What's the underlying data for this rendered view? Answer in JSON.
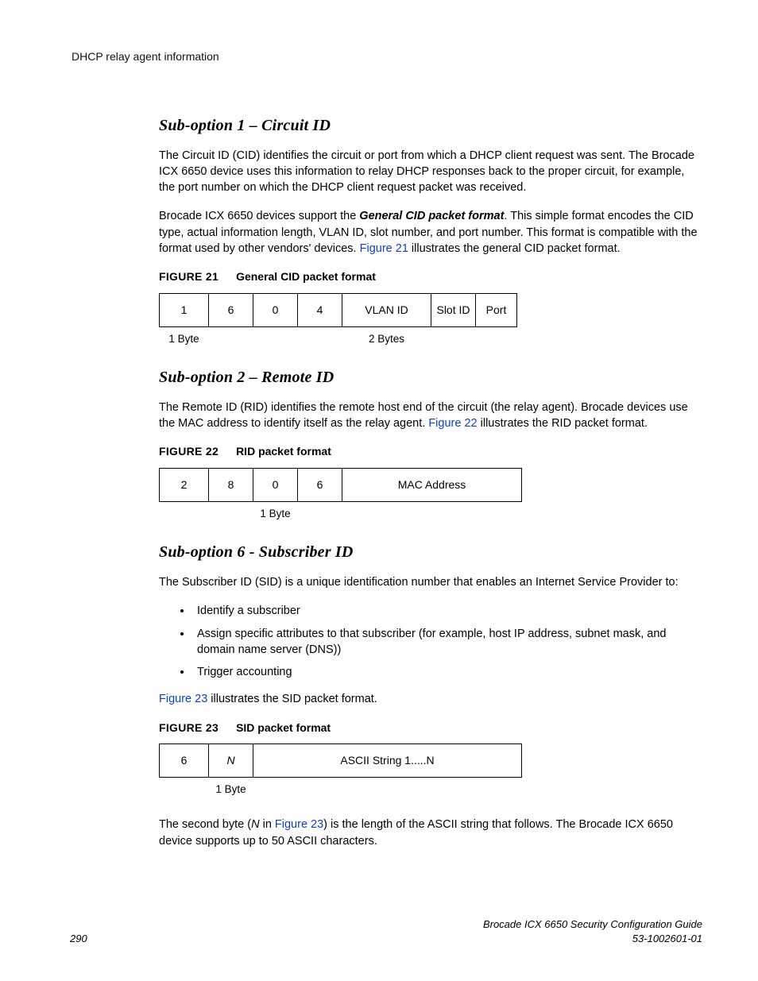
{
  "header": {
    "title": "DHCP relay agent information"
  },
  "section1": {
    "heading": "Sub-option 1 – Circuit ID",
    "para1": "The Circuit ID (CID) identifies the circuit or port from which a DHCP client request was sent. The Brocade ICX 6650 device uses this information to relay DHCP responses back to the proper circuit, for example, the port number on which the DHCP client request packet was received.",
    "para2_a": "Brocade ICX 6650 devices support the ",
    "para2_bold": "General CID packet format",
    "para2_b": ". This simple format encodes the CID type, actual information length, VLAN ID, slot number, and port number. This format is compatible with the format used by other vendors' devices. ",
    "para2_ref": "Figure 21",
    "para2_c": " illustrates the general CID packet format.",
    "fig": {
      "label": "FIGURE 21",
      "title": "General CID packet format",
      "cells": [
        "1",
        "6",
        "0",
        "4",
        "VLAN ID",
        "Slot ID",
        "Port"
      ],
      "under": {
        "c0": "1 Byte",
        "c4": "2 Bytes"
      }
    }
  },
  "section2": {
    "heading": "Sub-option 2 – Remote ID",
    "para1_a": "The Remote ID (RID) identifies the remote host end of the circuit (the relay agent). Brocade devices use the MAC address to identify itself as the relay agent. ",
    "para1_ref": "Figure 22",
    "para1_b": " illustrates the RID packet format.",
    "fig": {
      "label": "FIGURE 22",
      "title": "RID packet format",
      "cells": [
        "2",
        "8",
        "0",
        "6",
        "MAC Address"
      ],
      "under": {
        "c2": "1 Byte"
      }
    }
  },
  "section3": {
    "heading": "Sub-option 6 - Subscriber ID",
    "para1": "The Subscriber ID (SID) is a unique identification number that enables an Internet Service Provider to:",
    "bullets": [
      "Identify a subscriber",
      "Assign specific attributes to that subscriber (for example, host IP address, subnet mask, and domain name server (DNS))",
      "Trigger accounting"
    ],
    "para2_ref": "Figure 23",
    "para2_b": " illustrates the SID packet format.",
    "fig": {
      "label": "FIGURE 23",
      "title": "SID packet format",
      "cells": [
        "6",
        "N",
        "ASCII String 1.....N"
      ],
      "under": {
        "c1": "1 Byte"
      }
    },
    "para3_a": "The second byte (",
    "para3_n": "N",
    "para3_b": " in ",
    "para3_ref": "Figure 23",
    "para3_c": ") is the length of the ASCII string that follows. The Brocade ICX 6650 device supports up to 50 ASCII characters."
  },
  "footer": {
    "page": "290",
    "doc_title": "Brocade ICX 6650 Security Configuration Guide",
    "doc_number": "53-1002601-01"
  }
}
